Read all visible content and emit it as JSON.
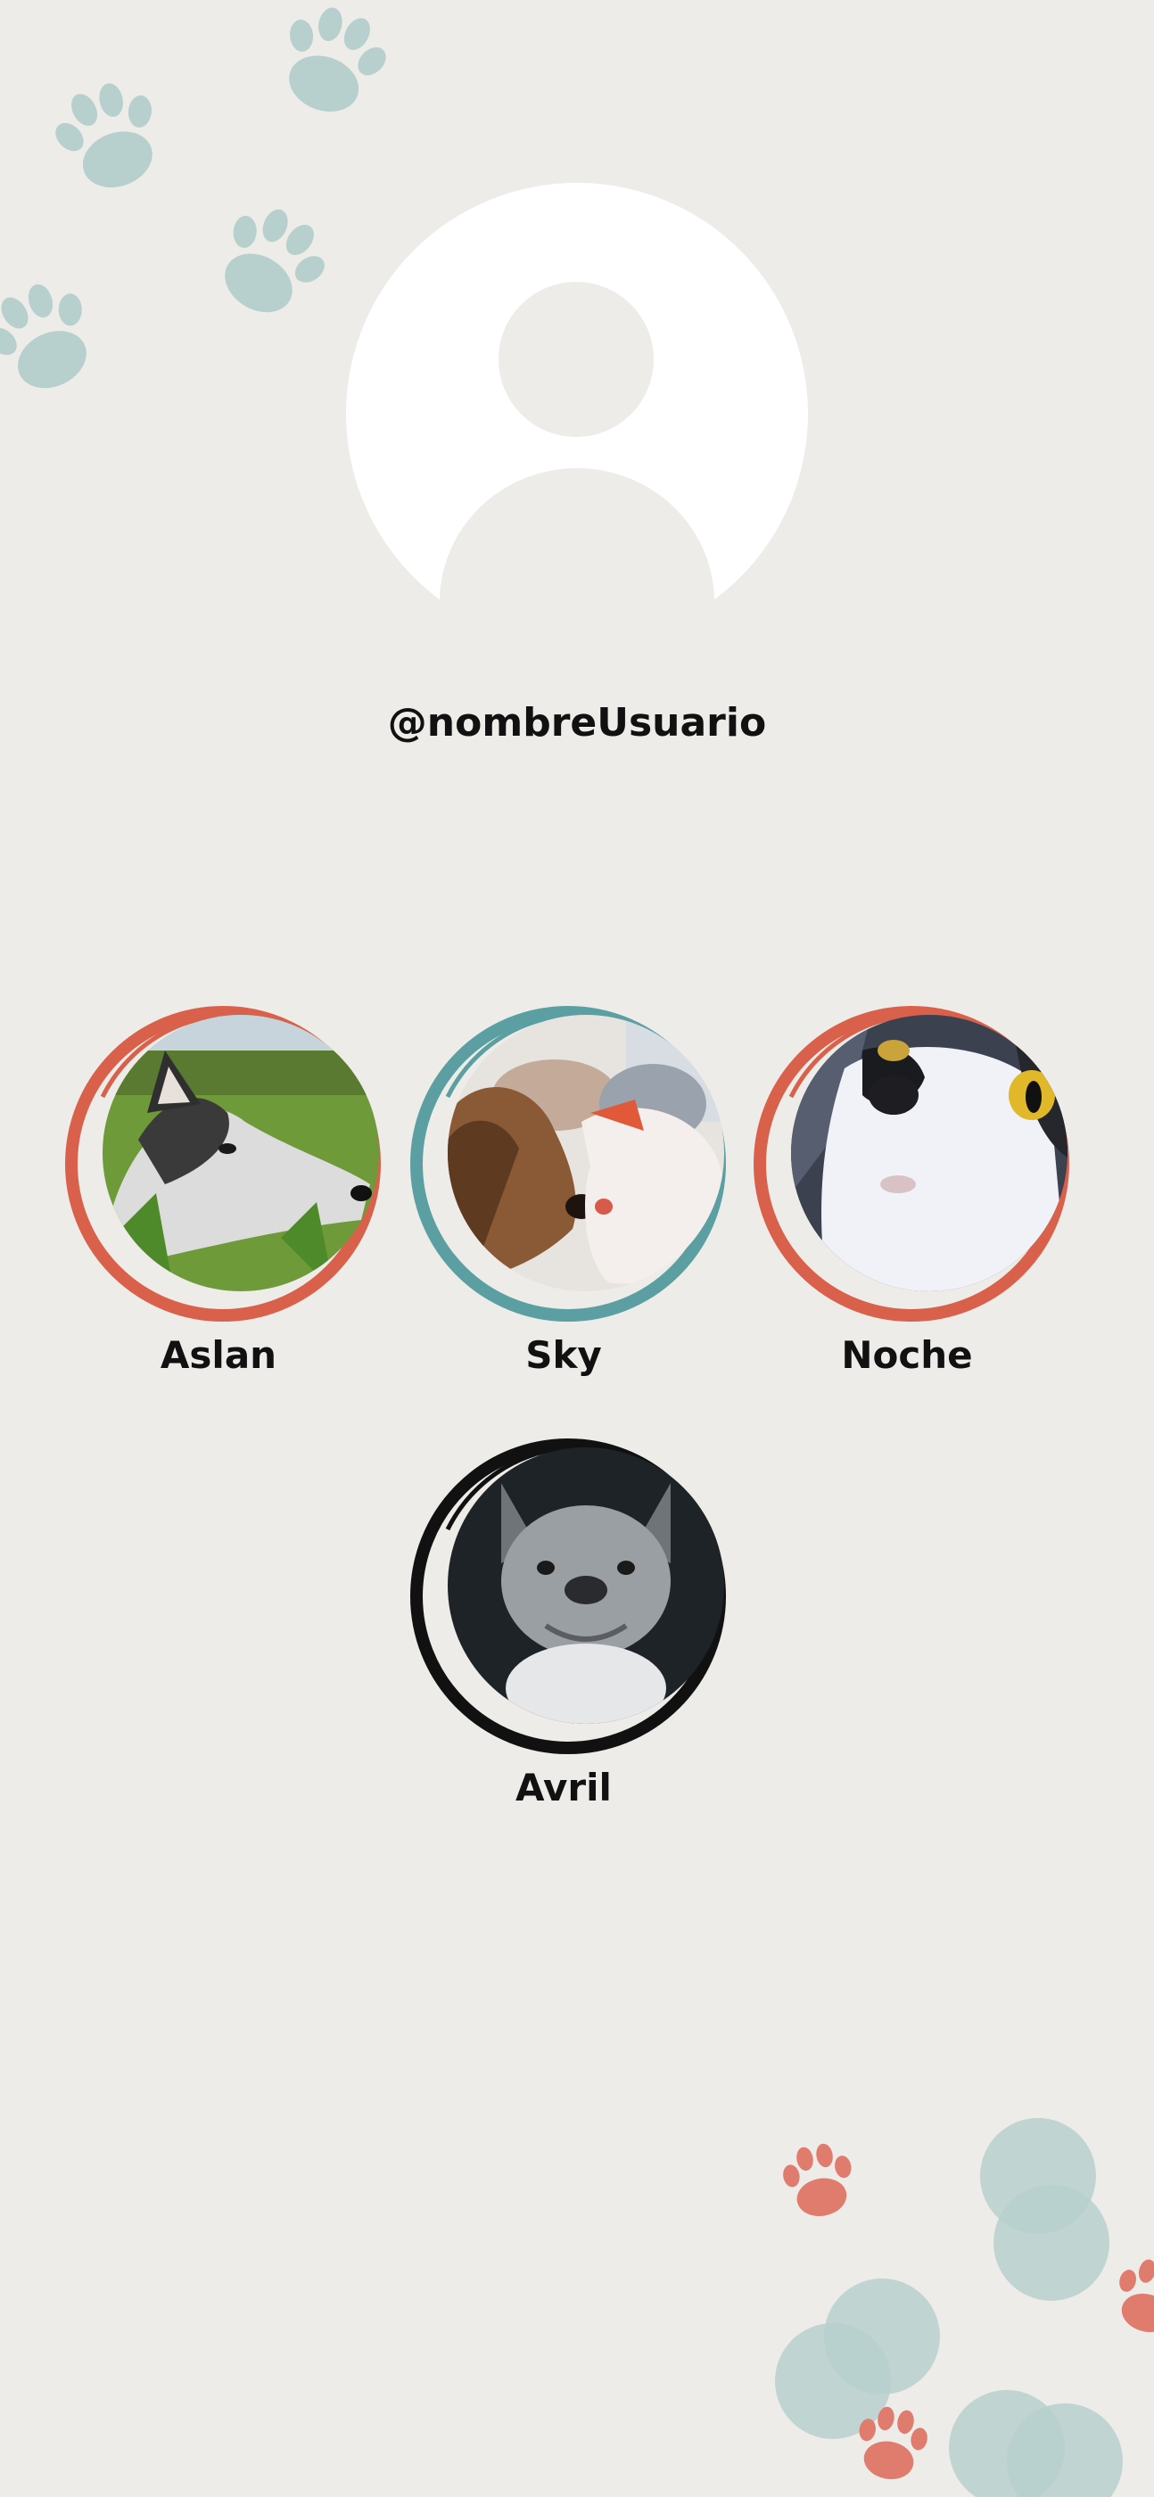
{
  "profile": {
    "username": "@nombreUsuario",
    "avatar_icon": "default-user-avatar-icon"
  },
  "pets": [
    {
      "name": "Aslan",
      "ring_color": "#d9614c",
      "photo": "husky-dog"
    },
    {
      "name": "Sky",
      "ring_color": "#5b9fa3",
      "photo": "dogs-kissing"
    },
    {
      "name": "Noche",
      "ring_color": "#d9614c",
      "photo": "black-white-cat"
    },
    {
      "name": "Avril",
      "ring_color": "#111111",
      "photo": "french-bulldog"
    }
  ],
  "colors": {
    "background": "#eeece8",
    "paw_teal": "#b7d0ce",
    "paw_coral": "#e07c6e"
  }
}
